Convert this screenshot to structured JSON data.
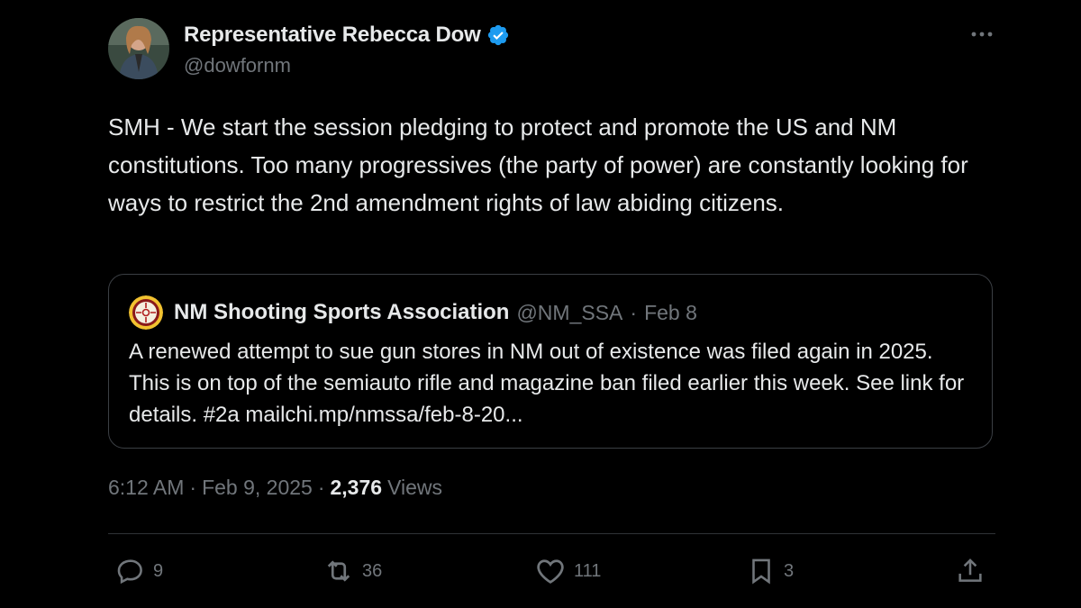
{
  "author": {
    "display_name": "Representative Rebecca Dow",
    "handle": "@dowfornm",
    "verified": true
  },
  "tweet": {
    "text": "SMH - We start the session pledging to protect and promote the US and NM constitutions. Too many progressives (the party of power) are constantly looking for ways to restrict the 2nd amendment rights of law abiding citizens."
  },
  "quoted_tweet": {
    "display_name": "NM Shooting Sports Association",
    "handle": "@NM_SSA",
    "separator": "·",
    "date": "Feb 8",
    "text": "A renewed attempt to sue gun stores in NM out of existence was filed again in 2025. This is on top of the semiauto rifle and magazine ban filed earlier this week. See link for details. #2a mailchi.mp/nmssa/feb-8-20..."
  },
  "meta": {
    "time": "6:12 AM",
    "separator": "·",
    "date": "Feb 9, 2025",
    "separator2": "·",
    "views_count": "2,376",
    "views_label": "Views"
  },
  "actions": {
    "replies": "9",
    "reposts": "36",
    "likes": "111",
    "bookmarks": "3"
  },
  "icons": {
    "more": "more-icon",
    "verified": "verified-badge-icon",
    "reply": "reply-icon",
    "repost": "repost-icon",
    "like": "heart-icon",
    "bookmark": "bookmark-icon",
    "share": "share-icon"
  },
  "colors": {
    "background": "#000000",
    "text": "#e7e9ea",
    "secondary": "#71767b",
    "verified": "#1d9bf0",
    "border": "#2f3336"
  }
}
